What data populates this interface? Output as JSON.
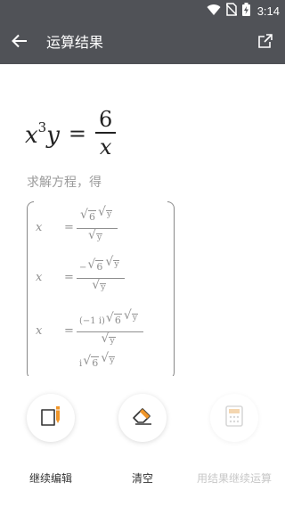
{
  "status_bar": {
    "time": "3:14",
    "icons": [
      "wifi-icon",
      "no-sim-icon",
      "battery-charging-icon"
    ]
  },
  "header": {
    "title": "运算结果",
    "back_icon": "arrow-left-icon",
    "share_icon": "share-icon"
  },
  "result": {
    "equation": {
      "lhs_x": "x",
      "lhs_exp": "3",
      "lhs_y": "y",
      "equals": "=",
      "rhs_num": "6",
      "rhs_den": "x"
    },
    "solve_label": "求解方程，得",
    "solutions": [
      {
        "var": "x",
        "eq": "=",
        "prefix": "",
        "r1": "6",
        "r2": "y",
        "den": "y"
      },
      {
        "var": "x",
        "eq": "=",
        "prefix": "−",
        "r1": "6",
        "r2": "y",
        "den": "y"
      },
      {
        "var": "x",
        "eq": "=",
        "prefix": "(−1 i)",
        "r1": "6",
        "r2": "y",
        "den": "y"
      },
      {
        "var": "",
        "eq": "",
        "prefix": "i",
        "r1": "6",
        "r2": "y",
        "den": ""
      }
    ]
  },
  "toolbar": {
    "items": [
      {
        "label": "继续编辑",
        "icon": "edit-icon",
        "enabled": true
      },
      {
        "label": "清空",
        "icon": "eraser-icon",
        "enabled": true
      },
      {
        "label": "用结果继续运算",
        "icon": "calculator-icon",
        "enabled": false
      }
    ]
  },
  "colors": {
    "app_bar": "#505257",
    "accent": "#f0962a",
    "disabled_text": "#c7c7c7"
  }
}
